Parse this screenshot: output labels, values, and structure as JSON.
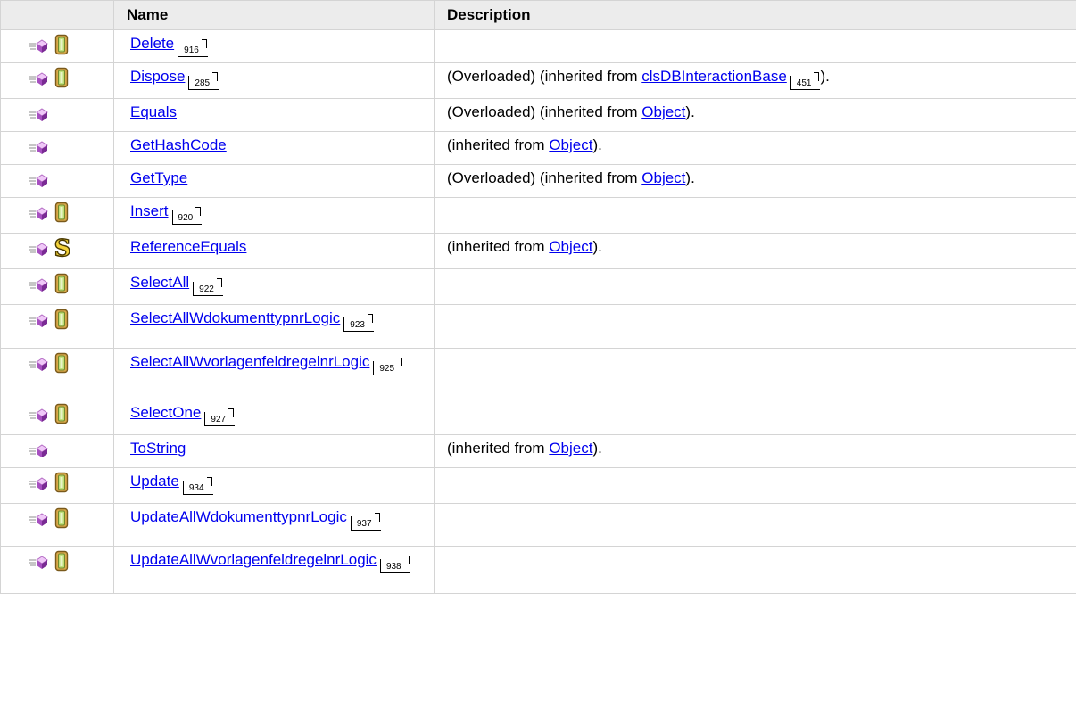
{
  "header": {
    "name": "Name",
    "description": "Description"
  },
  "rows": [
    {
      "name": "Delete",
      "ref": "916",
      "icon": "method-icon",
      "badge": "instance",
      "desc": []
    },
    {
      "name": "Dispose",
      "ref": "285",
      "icon": "method-icon",
      "badge": "instance",
      "desc": [
        "(Overloaded) (inherited from ",
        {
          "link": "clsDBInteractionBase",
          "ref": "451"
        },
        ")."
      ]
    },
    {
      "name": "Equals",
      "ref": "",
      "icon": "method-icon",
      "badge": "",
      "desc": [
        "(Overloaded) (inherited from ",
        {
          "link": "Object"
        },
        ")."
      ]
    },
    {
      "name": "GetHashCode",
      "ref": "",
      "icon": "method-icon",
      "badge": "",
      "desc": [
        "(inherited from ",
        {
          "link": "Object"
        },
        ")."
      ]
    },
    {
      "name": "GetType",
      "ref": "",
      "icon": "method-icon",
      "badge": "",
      "desc": [
        "(Overloaded) (inherited from ",
        {
          "link": "Object"
        },
        ")."
      ]
    },
    {
      "name": "Insert",
      "ref": "920",
      "icon": "method-icon",
      "badge": "instance",
      "desc": []
    },
    {
      "name": "ReferenceEquals",
      "ref": "",
      "icon": "method-icon",
      "badge": "static",
      "desc": [
        "(inherited from ",
        {
          "link": "Object"
        },
        ")."
      ]
    },
    {
      "name": "SelectAll",
      "ref": "922",
      "icon": "method-icon",
      "badge": "instance",
      "desc": []
    },
    {
      "name": "SelectAllWdokumenttypnrLogic",
      "ref": "923",
      "icon": "method-icon",
      "badge": "instance",
      "desc": []
    },
    {
      "name": "SelectAllWvorlagenfeldregelnrLogic",
      "ref": "925",
      "icon": "method-icon",
      "badge": "instance",
      "desc": []
    },
    {
      "name": "SelectOne",
      "ref": "927",
      "icon": "method-icon",
      "badge": "instance",
      "desc": []
    },
    {
      "name": "ToString",
      "ref": "",
      "icon": "method-icon",
      "badge": "",
      "desc": [
        "(inherited from ",
        {
          "link": "Object"
        },
        ")."
      ]
    },
    {
      "name": "Update",
      "ref": "934",
      "icon": "method-icon",
      "badge": "instance",
      "desc": []
    },
    {
      "name": "UpdateAllWdokumenttypnrLogic",
      "ref": "937",
      "icon": "method-icon",
      "badge": "instance",
      "desc": []
    },
    {
      "name": "UpdateAllWvorlagenfeldregelnrLogic",
      "ref": "938",
      "icon": "method-icon",
      "badge": "instance",
      "desc": []
    }
  ],
  "colors": {
    "link": "#0000ee",
    "header_bg": "#ececec",
    "grid": "#d4d4d4"
  }
}
